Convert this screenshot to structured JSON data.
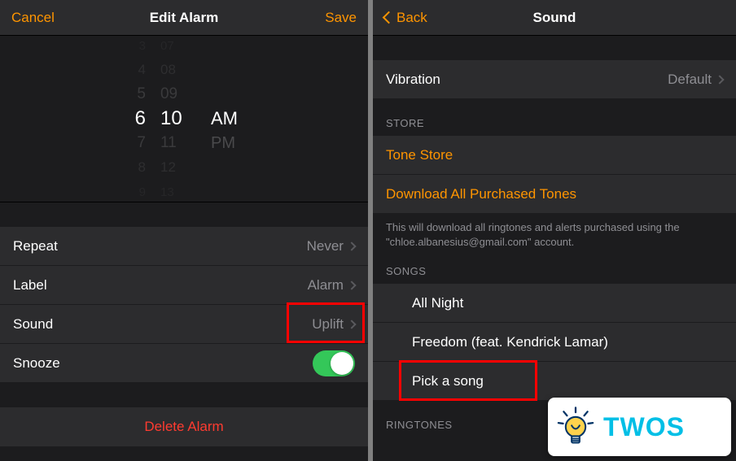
{
  "left": {
    "nav": {
      "cancel": "Cancel",
      "title": "Edit Alarm",
      "save": "Save"
    },
    "picker": {
      "hours": [
        "3",
        "4",
        "5",
        "6",
        "7",
        "8",
        "9"
      ],
      "minutes": [
        "07",
        "08",
        "09",
        "10",
        "11",
        "12",
        "13"
      ],
      "ampm": [
        "AM",
        "PM"
      ],
      "selected_index": 3,
      "ampm_selected": 0
    },
    "rows": {
      "repeat": {
        "label": "Repeat",
        "value": "Never"
      },
      "label": {
        "label": "Label",
        "value": "Alarm"
      },
      "sound": {
        "label": "Sound",
        "value": "Uplift"
      },
      "snooze": {
        "label": "Snooze",
        "on": true
      }
    },
    "delete": "Delete Alarm"
  },
  "right": {
    "nav": {
      "back": "Back",
      "title": "Sound"
    },
    "vibration": {
      "label": "Vibration",
      "value": "Default"
    },
    "store": {
      "header": "STORE",
      "tone_store": "Tone Store",
      "download_all": "Download All Purchased Tones",
      "note": "This will download all ringtones and alerts purchased using the \"chloe.albanesius@gmail.com\" account."
    },
    "songs": {
      "header": "SONGS",
      "items": [
        "All Night",
        "Freedom (feat. Kendrick Lamar)"
      ],
      "pick": "Pick a song"
    },
    "ringtones_header": "RINGTONES"
  },
  "branding": {
    "name": "TWOS"
  }
}
